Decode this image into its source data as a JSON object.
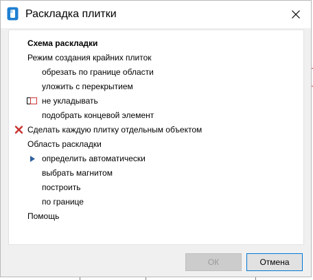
{
  "window": {
    "title": "Раскладка плитки",
    "close_icon": "close-icon",
    "app_icon": "app-icon"
  },
  "menu": {
    "header": "Схема раскладки",
    "edge_mode_label": "Режим создания крайних плиток",
    "edge_options": [
      "обрезать по границе области",
      "уложить с перекрытием",
      "не укладывать",
      "подобрать концевой элемент"
    ],
    "separate_objects": "Сделать каждую плитку отдельным объектом",
    "area_label": "Область раскладки",
    "area_options": [
      "определить автоматически",
      "выбрать магнитом",
      "построить",
      "по границе"
    ],
    "help": "Помощь"
  },
  "buttons": {
    "ok": "ОК",
    "cancel": "Отмена"
  },
  "colors": {
    "accent": "#0078d7",
    "x_mark": "#c83232",
    "arrow": "#2f5f9f"
  }
}
